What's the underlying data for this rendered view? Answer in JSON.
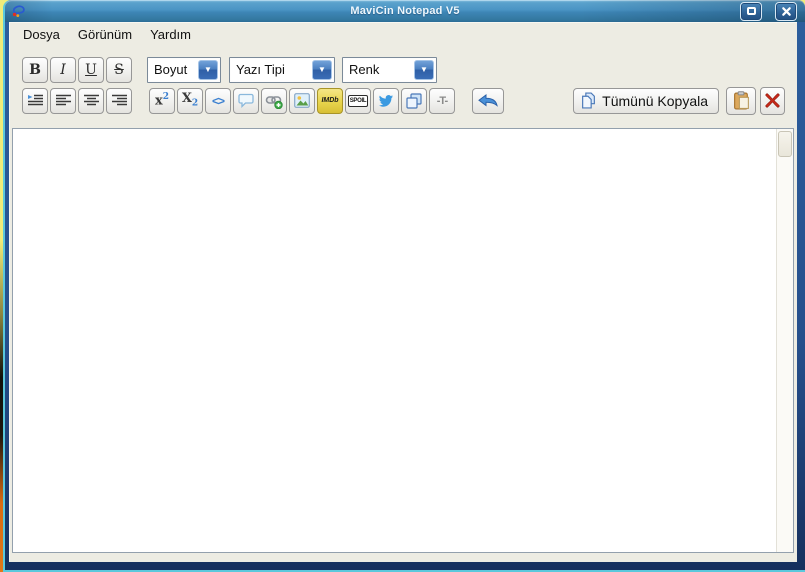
{
  "window": {
    "title": "MaviCin Notepad V5"
  },
  "menu": {
    "items": [
      {
        "label": "Dosya"
      },
      {
        "label": "Görünüm"
      },
      {
        "label": "Yardım"
      }
    ]
  },
  "format_toolbar": {
    "bold_label": "B",
    "italic_label": "I",
    "underline_label": "U",
    "strike_label": "S",
    "size_dropdown_value": "Boyut",
    "font_dropdown_value": "Yazı Tipi",
    "color_dropdown_value": "Renk",
    "dropdown_arrow": "▼"
  },
  "insert_toolbar": {
    "superscript_base": "x",
    "superscript_exp": "2",
    "subscript_base": "X",
    "subscript_sub": "2",
    "code_label": "<>",
    "imdb_label": "IMDb",
    "spoiler_label": "SPOIL",
    "strike_text_label": "-T-",
    "copy_all_label": "Tümünü Kopyala"
  },
  "editor": {
    "content": ""
  },
  "colors": {
    "titlebar_blue": "#4a94c4",
    "frame_navy": "#254f8c",
    "frame_cyan": "#5ac8dc",
    "dropdown_button_blue": "#3a6db6",
    "imdb_yellow": "#e8d44d",
    "close_red": "#c82a1a",
    "twitter_blue": "#3b9ae1"
  }
}
